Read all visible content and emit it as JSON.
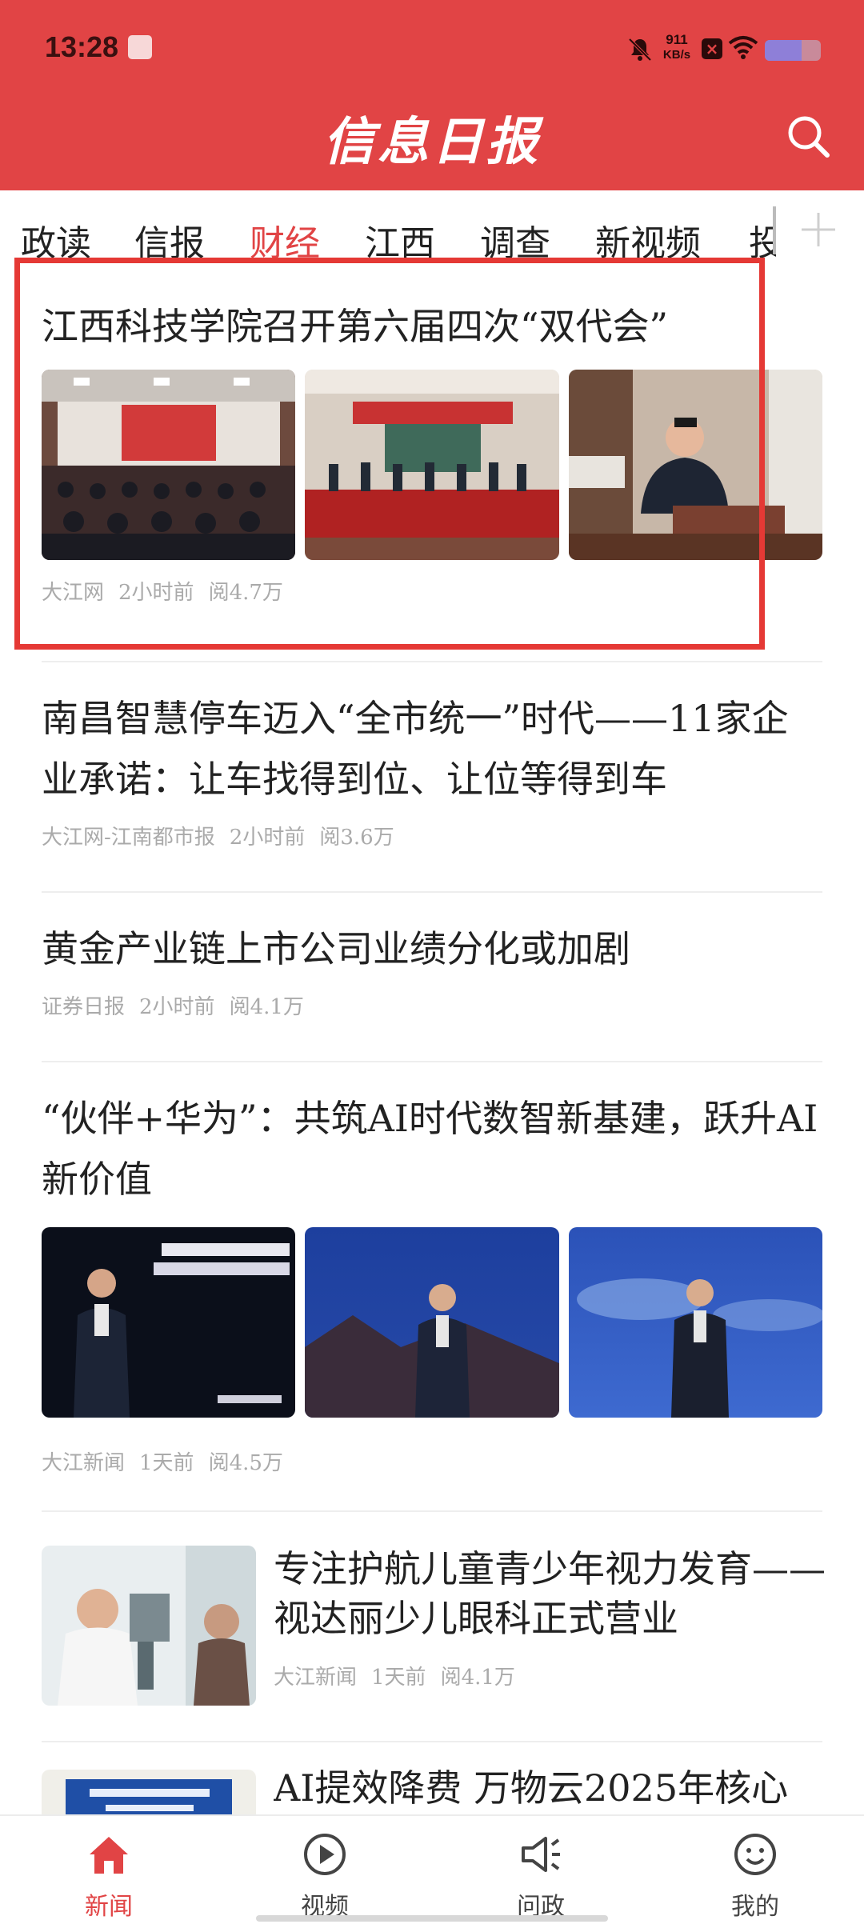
{
  "status_bar": {
    "time": "13:28",
    "net_speed_value": "911",
    "net_speed_unit": "KB/s",
    "battery_level": 0.65
  },
  "header": {
    "logo_text": "信息日报",
    "brand_color": "#e14445"
  },
  "tabs": [
    {
      "label": "政读",
      "active": false
    },
    {
      "label": "信报",
      "active": false
    },
    {
      "label": "财经",
      "active": true
    },
    {
      "label": "江西",
      "active": false
    },
    {
      "label": "调查",
      "active": false
    },
    {
      "label": "新视频",
      "active": false
    },
    {
      "label": "投",
      "active": false
    }
  ],
  "articles": [
    {
      "title": "江西科技学院召开第六届四次“双代会”",
      "source": "大江网",
      "time": "2小时前",
      "reads": "阅4.7万"
    },
    {
      "title": "南昌智慧停车迈入“全市统一”时代——11家企业承诺：让车找得到位、让位等得到车",
      "source": "大江网-江南都市报",
      "time": "2小时前",
      "reads": "阅3.6万"
    },
    {
      "title": "黄金产业链上市公司业绩分化或加剧",
      "source": "证券日报",
      "time": "2小时前",
      "reads": "阅4.1万"
    },
    {
      "title": "“伙伴+华为”：共筑AI时代数智新基建，跃升AI新价值",
      "source": "大江新闻",
      "time": "1天前",
      "reads": "阅4.5万"
    },
    {
      "title": "专注护航儿童青少年视力发育——视达丽少儿眼科正式营业",
      "source": "大江新闻",
      "time": "1天前",
      "reads": "阅4.1万"
    },
    {
      "title": "AI提效降费 万物云2025年核心",
      "source": "",
      "time": "",
      "reads": ""
    }
  ],
  "bottom_nav": [
    {
      "label": "新闻",
      "icon": "home-icon",
      "active": true
    },
    {
      "label": "视频",
      "icon": "play-icon",
      "active": false
    },
    {
      "label": "问政",
      "icon": "megaphone-icon",
      "active": false
    },
    {
      "label": "我的",
      "icon": "smile-icon",
      "active": false
    }
  ]
}
